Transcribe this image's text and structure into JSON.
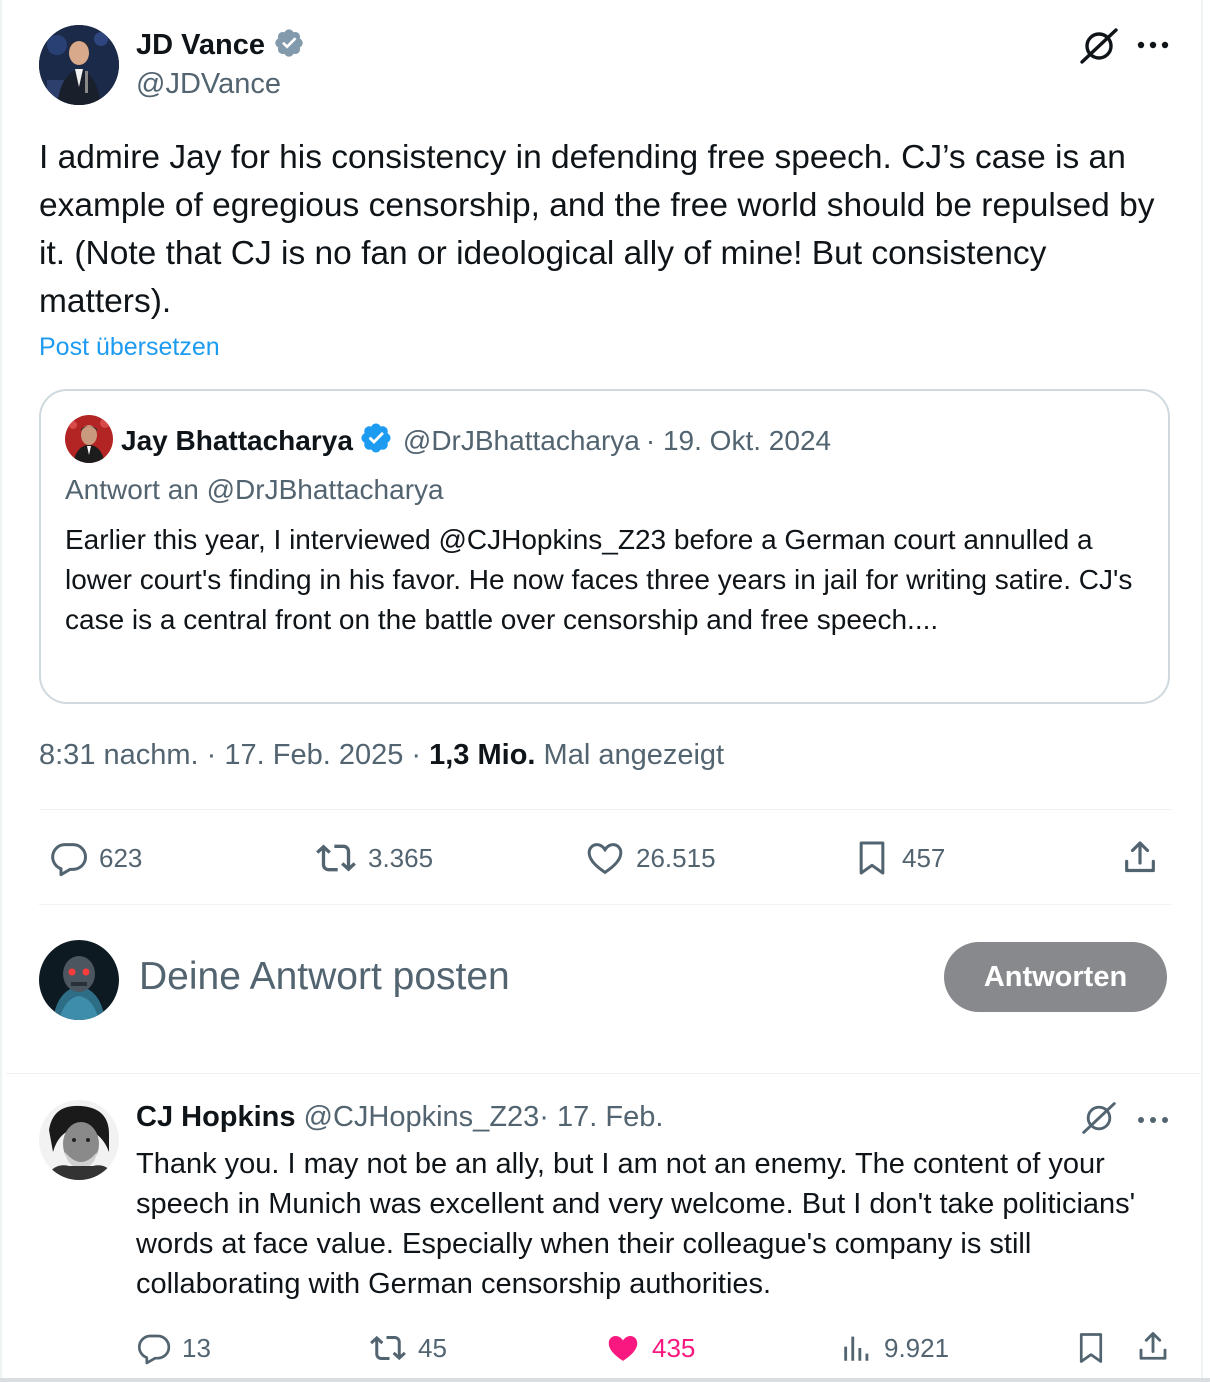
{
  "main_post": {
    "author_name": "JD Vance",
    "author_handle": "@JDVance",
    "text": "I admire Jay for his consistency in defending free speech. CJ’s case is an example of egregious censorship, and the free world should be repulsed by it. (Note that CJ is no fan or ideological ally of mine! But consistency matters).",
    "translate_label": "Post übersetzen",
    "timestamp": "8:31 nachm. · 17. Feb. 2025 · ",
    "views_count": "1,3 Mio.",
    "views_label": " Mal angezeigt",
    "stats": {
      "replies": "623",
      "reposts": "3.365",
      "likes": "26.515",
      "bookmarks": "457"
    }
  },
  "quoted_post": {
    "author_name": "Jay Bhattacharya",
    "author_handle": "@DrJBhattacharya",
    "date": " · 19. Okt. 2024",
    "reply_to": "Antwort an @DrJBhattacharya",
    "text": "Earlier this year, I interviewed @CJHopkins_Z23 before a German court annulled a lower court's finding in his favor. He now faces three years in jail for writing satire. CJ's case is a central front on the battle over censorship and free speech...."
  },
  "composer": {
    "placeholder": "Deine Antwort posten",
    "reply_button": "Antworten"
  },
  "reply_post": {
    "author_name": "CJ Hopkins",
    "author_handle": "@CJHopkins_Z23",
    "date": " · 17. Feb.",
    "text": "Thank you. I may not be an ally, but I am not an enemy. The content of your speech in Munich was excellent and very welcome. But I don't take politicians' words at face value. Especially when their colleague's company is still collaborating with German censorship authorities.",
    "stats": {
      "replies": "13",
      "reposts": "45",
      "likes": "435",
      "views": "9.921"
    }
  },
  "colors": {
    "text": "#0f1419",
    "muted": "#536471",
    "link": "#1d9bf0",
    "liked": "#f91880",
    "reply_button_bg": "#87898c",
    "border": "#cfd9de"
  },
  "icons": [
    "verified-badge-icon",
    "grok-icon",
    "more-icon",
    "reply-icon",
    "repost-icon",
    "like-icon",
    "bookmark-icon",
    "share-icon",
    "views-icon"
  ]
}
